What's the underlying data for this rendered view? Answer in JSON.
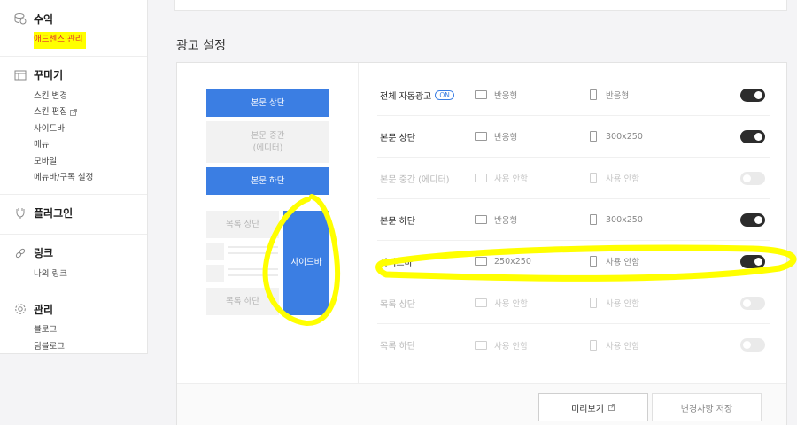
{
  "sidebar": {
    "sections": [
      {
        "title": "수익",
        "icon": "coin-icon",
        "items": [
          {
            "label": "애드센스 관리",
            "highlighted": true
          }
        ]
      },
      {
        "title": "꾸미기",
        "icon": "layout-icon",
        "items": [
          {
            "label": "스킨 변경"
          },
          {
            "label": "스킨 편집",
            "external": true
          },
          {
            "label": "사이드바"
          },
          {
            "label": "메뉴"
          },
          {
            "label": "모바일"
          },
          {
            "label": "메뉴바/구독 설정"
          }
        ]
      },
      {
        "title": "플러그인",
        "icon": "plug-icon",
        "items": []
      },
      {
        "title": "링크",
        "icon": "link-icon",
        "items": [
          {
            "label": "나의 링크"
          }
        ]
      },
      {
        "title": "관리",
        "icon": "gear-icon",
        "items": [
          {
            "label": "블로그"
          },
          {
            "label": "팀블로그"
          }
        ]
      }
    ]
  },
  "main": {
    "section_title": "광고 설정",
    "preview": {
      "body_top": "본문 상단",
      "body_middle_line1": "본문 중간",
      "body_middle_line2": "(에디터)",
      "body_bottom": "본문 하단",
      "list_top": "목록 상단",
      "list_bottom": "목록 하단",
      "sidebar": "사이드바"
    },
    "rows": [
      {
        "label": "전체 자동광고",
        "badge": "ON",
        "pc": "반응형",
        "mobile": "반응형",
        "enabled": true
      },
      {
        "label": "본문 상단",
        "pc": "반응형",
        "mobile": "300x250",
        "enabled": true
      },
      {
        "label": "본문 중간 (에디터)",
        "pc": "사용 안함",
        "mobile": "사용 안함",
        "enabled": false
      },
      {
        "label": "본문 하단",
        "pc": "반응형",
        "mobile": "300x250",
        "enabled": true
      },
      {
        "label": "사이드바",
        "pc": "250x250",
        "mobile": "사용 안함",
        "enabled": true
      },
      {
        "label": "목록 상단",
        "pc": "사용 안함",
        "mobile": "사용 안함",
        "enabled": false
      },
      {
        "label": "목록 하단",
        "pc": "사용 안함",
        "mobile": "사용 안함",
        "enabled": false
      }
    ],
    "buttons": {
      "preview": "미리보기",
      "save": "변경사항 저장"
    }
  },
  "colors": {
    "accent": "#3b7ee3",
    "highlight": "#ffff00",
    "toggle_on": "#2c2c2c",
    "toggle_off": "#eaeaea",
    "highlight_text": "#e0342c"
  }
}
